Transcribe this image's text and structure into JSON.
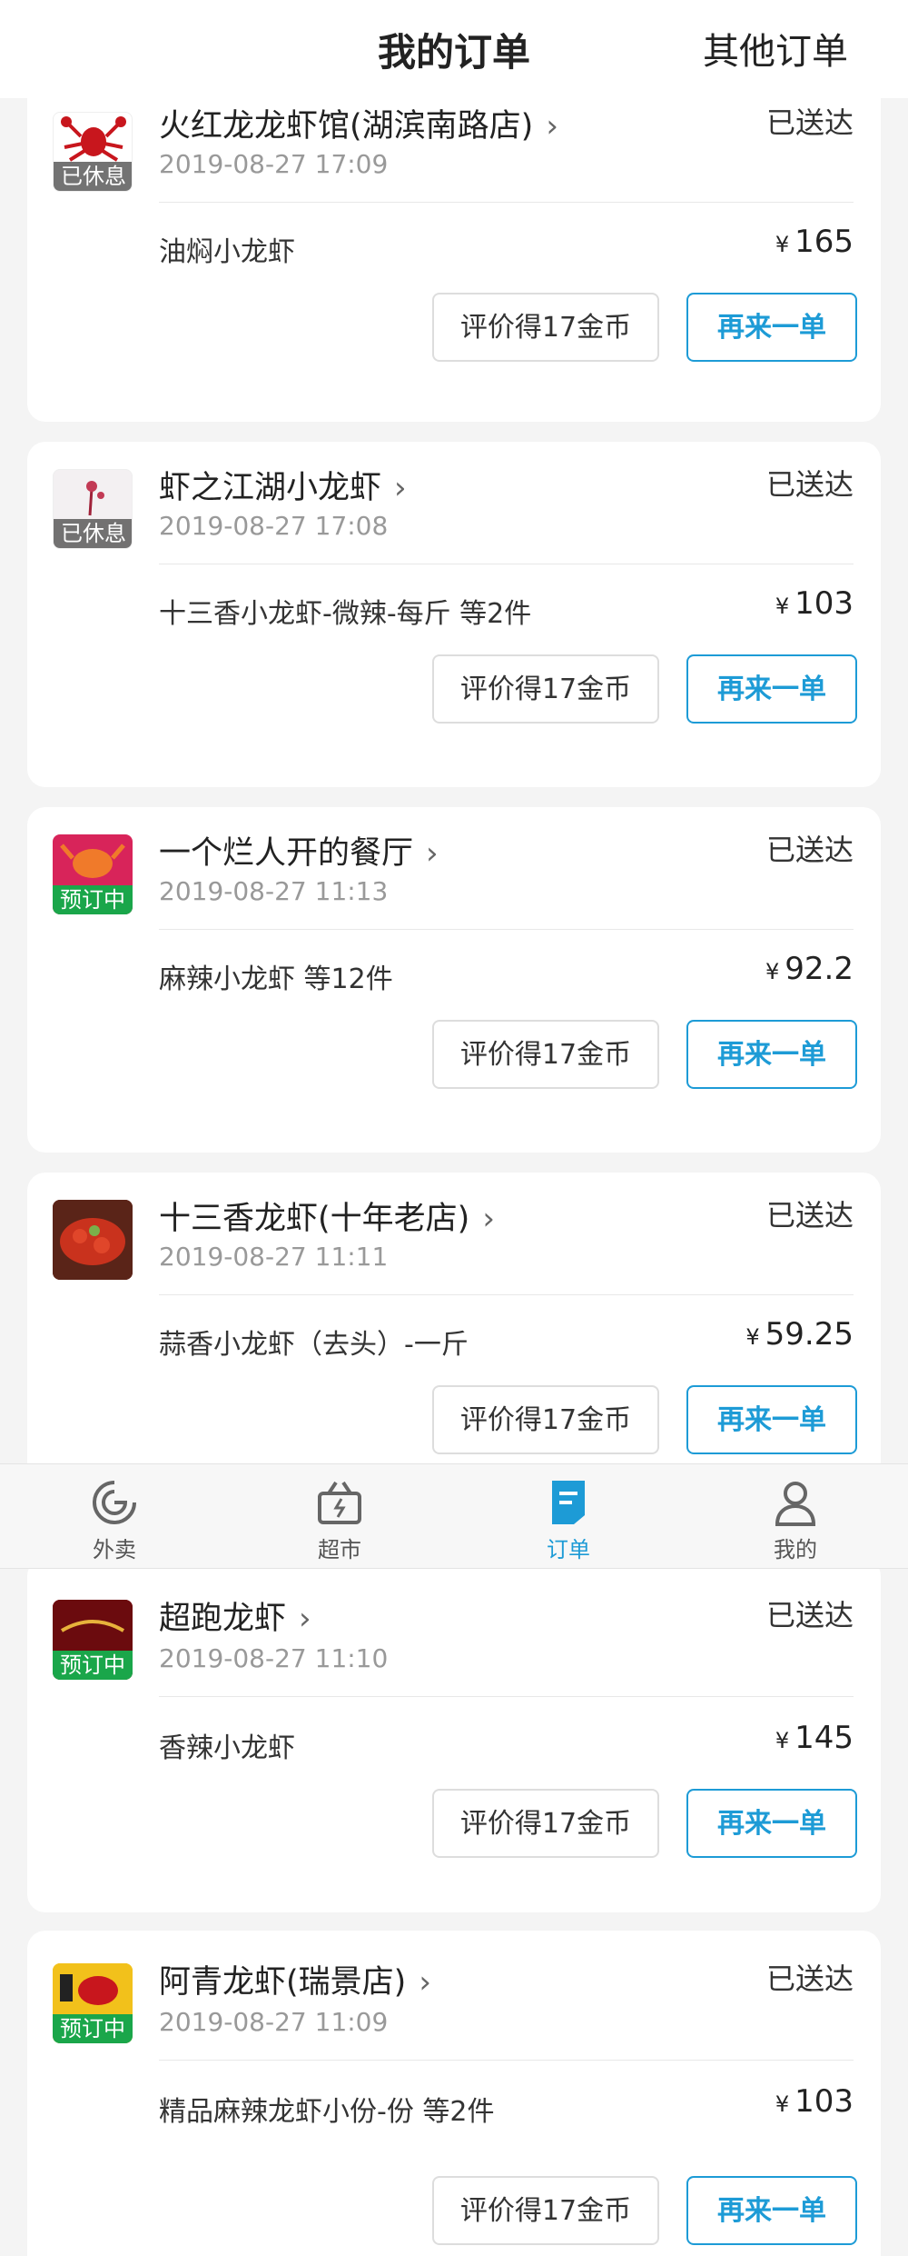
{
  "header": {
    "title": "我的订单",
    "other_orders": "其他订单"
  },
  "orders": [
    {
      "shop": "火红龙龙虾馆(湖滨南路店)",
      "badge": "已休息",
      "status": "已送达",
      "time": "2019-08-27 17:09",
      "item": "油焖小龙虾",
      "currency": "¥",
      "price": "165",
      "review": "评价得17金币",
      "reorder": "再来一单",
      "logo_color": "#ffffff"
    },
    {
      "shop": "虾之江湖小龙虾",
      "badge": "已休息",
      "status": "已送达",
      "time": "2019-08-27 17:08",
      "item": "十三香小龙虾-微辣-每斤  等2件",
      "currency": "¥",
      "price": "103",
      "review": "评价得17金币",
      "reorder": "再来一单",
      "logo_color": "#f3f0f2"
    },
    {
      "shop": "一个烂人开的餐厅",
      "badge": "预订中",
      "status": "已送达",
      "time": "2019-08-27 11:13",
      "item": "麻辣小龙虾  等12件",
      "currency": "¥",
      "price": "92.2",
      "review": "评价得17金币",
      "reorder": "再来一单",
      "logo_color": "#d8245a"
    },
    {
      "shop": "十三香龙虾(十年老店)",
      "badge": "",
      "status": "已送达",
      "time": "2019-08-27 11:11",
      "item": "蒜香小龙虾（去头）-一斤",
      "currency": "¥",
      "price": "59.25",
      "review": "评价得17金币",
      "reorder": "再来一单",
      "logo_color": "#8a2a1e"
    },
    {
      "shop": "超跑龙虾",
      "badge": "预订中",
      "status": "已送达",
      "time": "2019-08-27 11:10",
      "item": "香辣小龙虾",
      "currency": "¥",
      "price": "145",
      "review": "评价得17金币",
      "reorder": "再来一单",
      "logo_color": "#b3141a"
    },
    {
      "shop": "阿青龙虾(瑞景店)",
      "badge": "预订中",
      "status": "已送达",
      "time": "2019-08-27 11:09",
      "item": "精品麻辣龙虾小份-份  等2件",
      "currency": "¥",
      "price": "103",
      "review": "评价得17金币",
      "reorder": "再来一单",
      "logo_color": "#f2c11b"
    }
  ],
  "tabbar": {
    "takeout": "外卖",
    "supermarket": "超市",
    "orders": "订单",
    "mine": "我的",
    "active_color": "#1d9bd6"
  }
}
